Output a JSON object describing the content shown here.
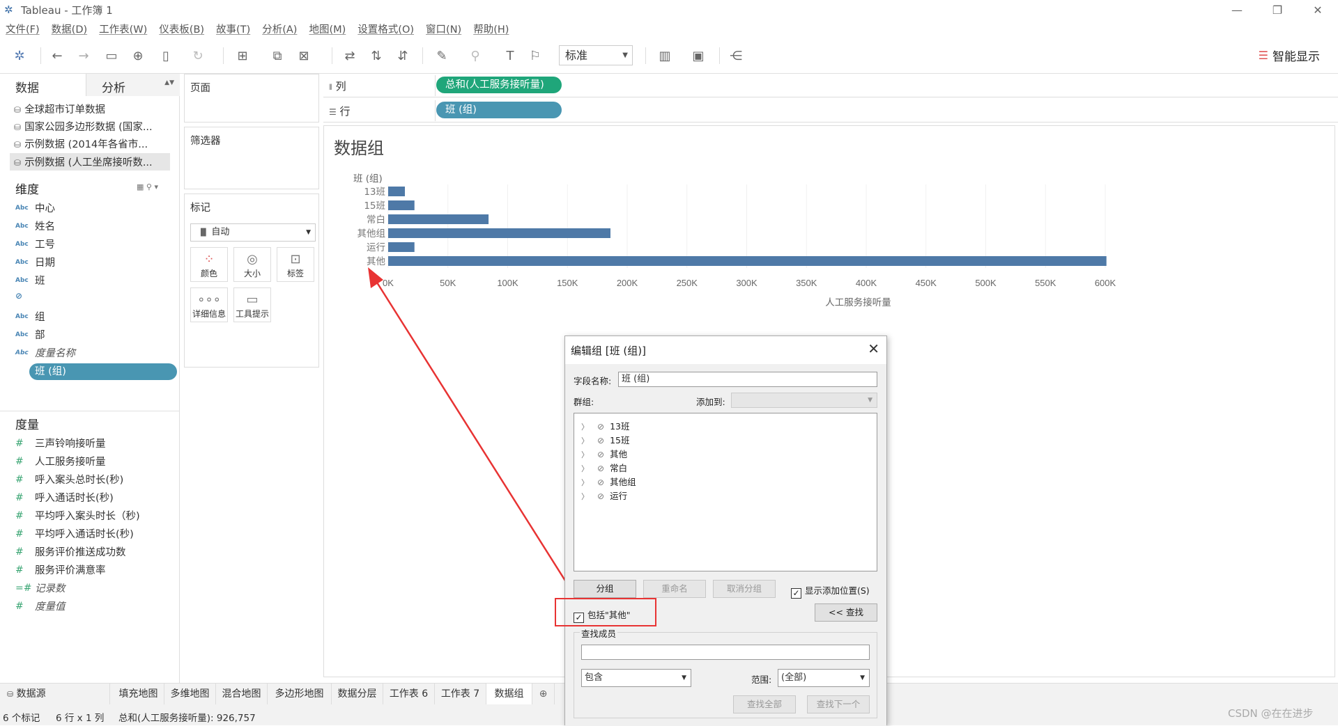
{
  "app": {
    "title": "Tableau - 工作簿 1"
  },
  "menu": [
    "文件(F)",
    "数据(D)",
    "工作表(W)",
    "仪表板(B)",
    "故事(T)",
    "分析(A)",
    "地图(M)",
    "设置格式(O)",
    "窗口(N)",
    "帮助(H)"
  ],
  "toolbar": {
    "fit_select": "标准",
    "show_me": "智能显示"
  },
  "left_panel": {
    "tab_data": "数据",
    "tab_analysis": "分析",
    "datasources": [
      "全球超市订单数据",
      "国家公园多边形数据 (国家...",
      "示例数据 (2014年各省市...",
      "示例数据 (人工坐席接听数..."
    ],
    "dimensions_title": "维度",
    "dimensions": [
      "中心",
      "姓名",
      "工号",
      "日期",
      "班",
      "班 (组)",
      "组",
      "部",
      "度量名称"
    ],
    "measures_title": "度量",
    "measures": [
      "三声铃响接听量",
      "人工服务接听量",
      "呼入案头总时长(秒)",
      "呼入通话时长(秒)",
      "平均呼入案头时长（秒)",
      "平均呼入通话时长(秒)",
      "服务评价推送成功数",
      "服务评价满意率",
      "记录数",
      "度量值"
    ]
  },
  "shelves": {
    "pages": "页面",
    "filters": "筛选器",
    "marks": "标记",
    "marks_type": "自动",
    "mark_buttons": [
      "颜色",
      "大小",
      "标签",
      "详细信息",
      "工具提示"
    ],
    "columns_label": "列",
    "rows_label": "行",
    "columns_pill": "总和(人工服务接听量)",
    "rows_pill": "班 (组)"
  },
  "viz": {
    "title": "数据组"
  },
  "chart_data": {
    "type": "bar",
    "orientation": "horizontal",
    "row_header": "班 (组)",
    "categories": [
      "13班",
      "15班",
      "常白",
      "其他组",
      "运行",
      "其他"
    ],
    "values": [
      14000,
      22000,
      84000,
      186000,
      22000,
      601000
    ],
    "xlabel": "人工服务接听量",
    "xlim": [
      0,
      600000
    ],
    "xticks": [
      "0K",
      "50K",
      "100K",
      "150K",
      "200K",
      "250K",
      "300K",
      "350K",
      "400K",
      "450K",
      "500K",
      "550K",
      "600K"
    ],
    "grid": true,
    "color": "#4e79a7"
  },
  "bottom_tabs": [
    "数据源",
    "填充地图",
    "多维地图",
    "混合地图",
    "多边形地图",
    "数据分层",
    "工作表 6",
    "工作表 7",
    "数据组"
  ],
  "status": {
    "marks": "6 个标记",
    "shape": "6 行 x 1 列",
    "sum": "总和(人工服务接听量): 926,757"
  },
  "dialog": {
    "title": "编辑组 [班 (组)]",
    "field_name_label": "字段名称:",
    "field_name_value": "班 (组)",
    "groups_label": "群组:",
    "add_to_label": "添加到:",
    "groups": [
      "13班",
      "15班",
      "其他",
      "常白",
      "其他组",
      "运行"
    ],
    "btn_group": "分组",
    "btn_rename": "重命名",
    "btn_ungroup": "取消分组",
    "show_add_location": "显示添加位置(S)",
    "include_other": "包括\"其他\"",
    "btn_find": "<< 查找",
    "find_members": "查找成员",
    "match_select": "包含",
    "range_label": "范围:",
    "range_select": "(全部)",
    "btn_find_all": "查找全部",
    "btn_find_next": "查找下一个"
  },
  "watermark": "CSDN @在在进步"
}
